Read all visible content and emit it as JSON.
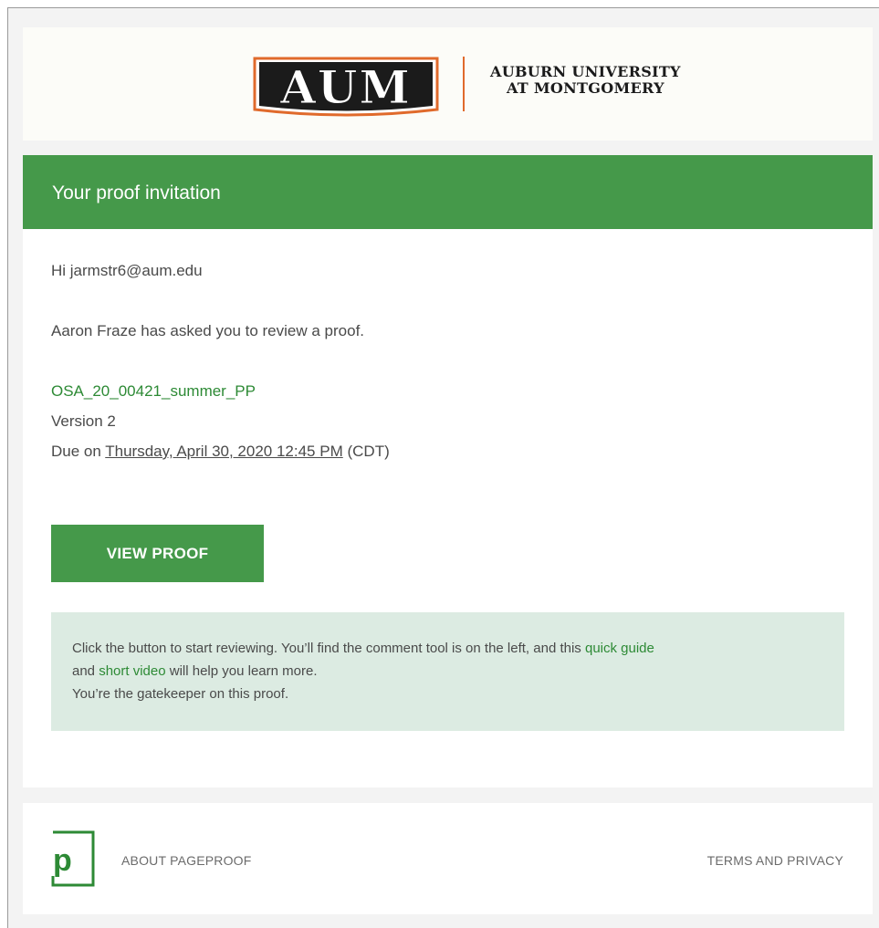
{
  "header": {
    "logo_alt": "AUM",
    "logo_line1": "AUBURN UNIVERSITY",
    "logo_line2": "AT MONTGOMERY"
  },
  "banner": {
    "title": "Your proof invitation"
  },
  "body": {
    "greeting": "Hi jarmstr6@aum.edu",
    "ask": "Aaron Fraze has asked you to review a proof.",
    "proof_name": "OSA_20_00421_summer_PP",
    "version": "Version 2",
    "due_prefix": "Due on ",
    "due_date": "Thursday, April 30, 2020 12:45 PM",
    "due_tz": " (CDT)",
    "button_label": "VIEW PROOF",
    "tip_part1": "Click the button to start reviewing. You’ll find the comment tool is on the left, and this ",
    "tip_link1": "quick guide",
    "tip_part2": " and ",
    "tip_link2": "short video",
    "tip_part3": " will help you learn more.",
    "tip_line2": "You’re the gatekeeper on this proof."
  },
  "footer": {
    "logo_letter": "p",
    "about_label": "ABOUT PAGEPROOF",
    "terms_label": "TERMS AND PRIVACY"
  },
  "colors": {
    "brand_green": "#45994a",
    "link_green": "#2d8a35",
    "tip_background": "#dcebe2",
    "aum_orange": "#e06a2c"
  }
}
